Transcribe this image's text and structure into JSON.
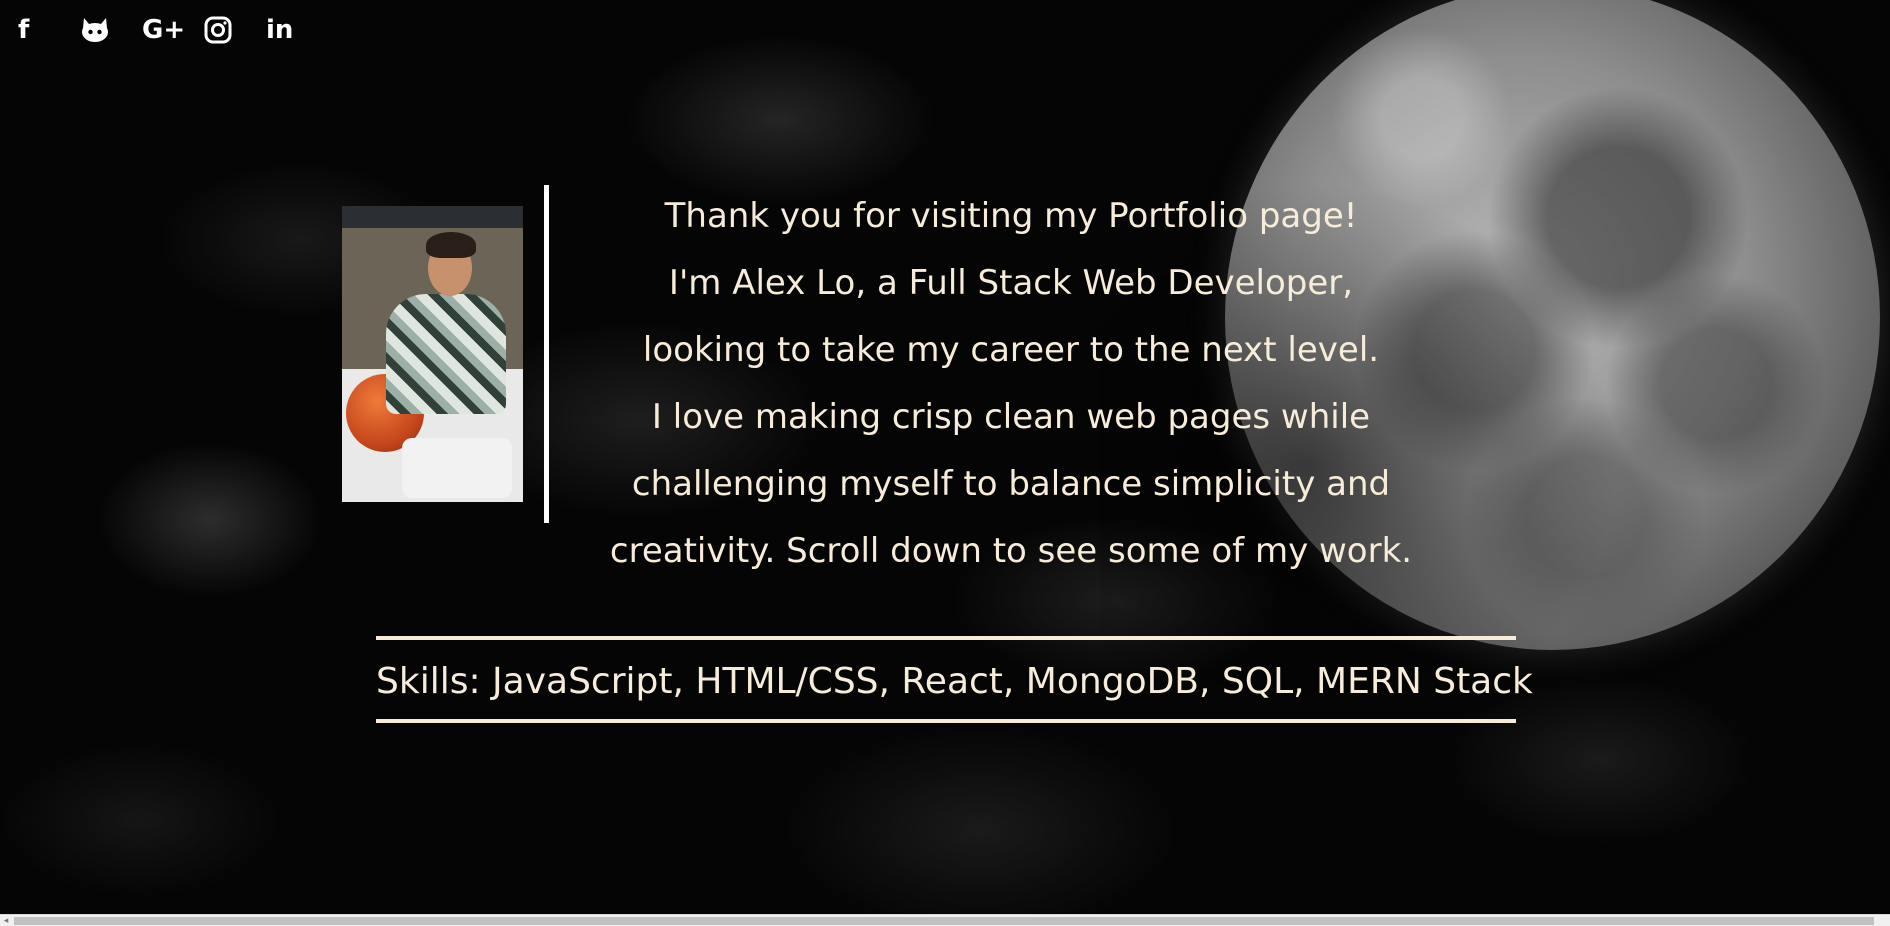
{
  "social_links": [
    {
      "icon": "facebook-icon",
      "glyph": "f"
    },
    {
      "icon": "github-icon",
      "glyph": ""
    },
    {
      "icon": "google-plus-icon",
      "glyph": "G+"
    },
    {
      "icon": "instagram-icon",
      "glyph": ""
    },
    {
      "icon": "linkedin-icon",
      "glyph": "in"
    }
  ],
  "bio": {
    "lines": [
      "Thank you for visiting my Portfolio page!",
      "I'm Alex Lo, a Full Stack Web Developer,",
      "looking to take my career to the next level.",
      "I love making crisp clean web pages while",
      "challenging myself to balance simplicity and",
      "creativity. Scroll down to see some of my work."
    ]
  },
  "skills": {
    "text": "Skills: JavaScript, HTML/CSS, React, MongoDB, SQL, MERN Stack"
  },
  "scrollbar": {
    "left_arrow": "◂"
  },
  "colors": {
    "text": "#f7ecd9",
    "background": "#000000",
    "rule": "#f7ecd9"
  }
}
